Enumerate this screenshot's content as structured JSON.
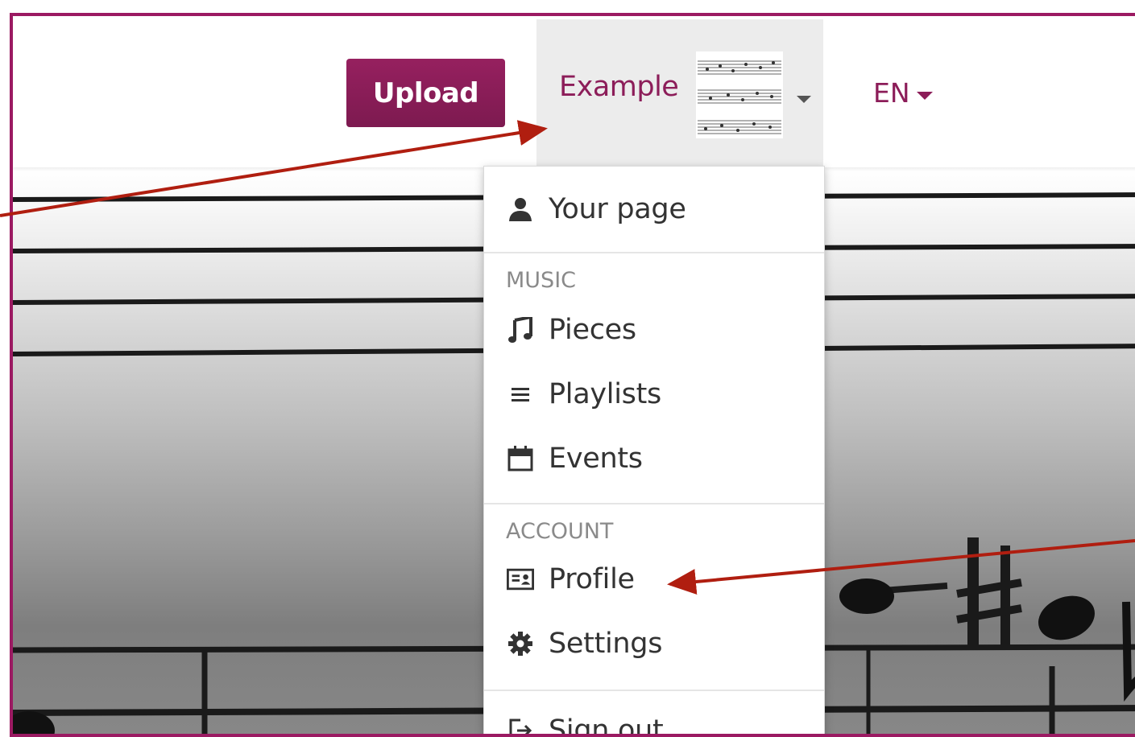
{
  "navbar": {
    "upload_label": "Upload",
    "user_name": "Example",
    "language": "EN"
  },
  "user_menu": {
    "your_page": "Your page",
    "music_header": "MUSIC",
    "music_items": [
      "Pieces",
      "Playlists",
      "Events"
    ],
    "account_header": "ACCOUNT",
    "account_items": [
      "Profile",
      "Settings"
    ],
    "sign_out": "Sign out"
  },
  "colors": {
    "brand": "#8c1d59",
    "border": "#9b1a62",
    "annotation": "#b01e10"
  },
  "icons": {
    "your_page": "user-icon",
    "pieces": "music-note-icon",
    "playlists": "list-icon",
    "events": "calendar-icon",
    "profile": "id-card-icon",
    "settings": "gear-icon",
    "sign_out": "sign-out-icon"
  }
}
